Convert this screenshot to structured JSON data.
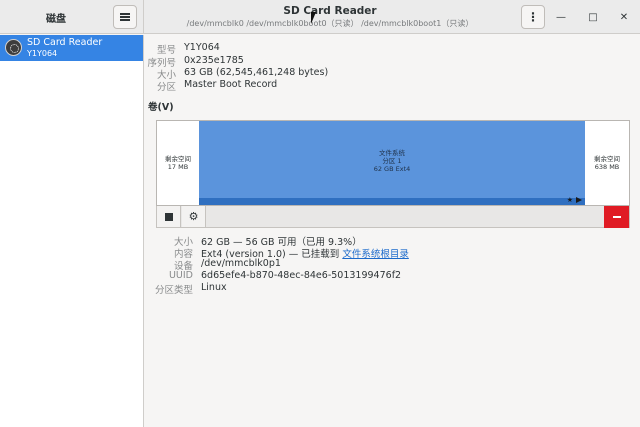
{
  "sidebar": {
    "title": "磁盘",
    "devices": [
      {
        "name": "SD Card Reader",
        "serial": "Y1Y064"
      }
    ]
  },
  "header": {
    "title": "SD Card Reader",
    "subtitle": "/dev/mmcblk0 /dev/mmcblk0boot0（只读） /dev/mmcblk0boot1（只读）"
  },
  "window_controls": {
    "minimize": "—",
    "maximize": "□",
    "close": "✕"
  },
  "device_info": [
    {
      "label": "型号",
      "value": "Y1Y064"
    },
    {
      "label": "序列号",
      "value": "0x235e1785"
    },
    {
      "label": "大小",
      "value": "63 GB (62,545,461,248 bytes)"
    },
    {
      "label": "分区",
      "value": "Master Boot Record"
    }
  ],
  "volumes": {
    "title": "卷(V)",
    "free_left": {
      "line1": "剩余空间",
      "line2": "17 MB"
    },
    "partition": {
      "line1": "文件系统",
      "line2": "分区 1",
      "line3": "62 GB Ext4"
    },
    "free_right": {
      "line1": "剩余空间",
      "line2": "638 MB"
    }
  },
  "volume_info": {
    "size": {
      "label": "大小",
      "value": "62 GB — 56 GB 可用（已用 9.3%）"
    },
    "contents": {
      "label": "内容",
      "value_prefix": "Ext4 (version 1.0) — 已挂载到 ",
      "link": "文件系统根目录"
    },
    "device": {
      "label": "设备",
      "value": "/dev/mmcblk0p1"
    },
    "uuid": {
      "label": "UUID",
      "value": "6d65efe4-b870-48ec-84e6-5013199476f2"
    },
    "partition_type": {
      "label": "分区类型",
      "value": "Linux"
    }
  }
}
